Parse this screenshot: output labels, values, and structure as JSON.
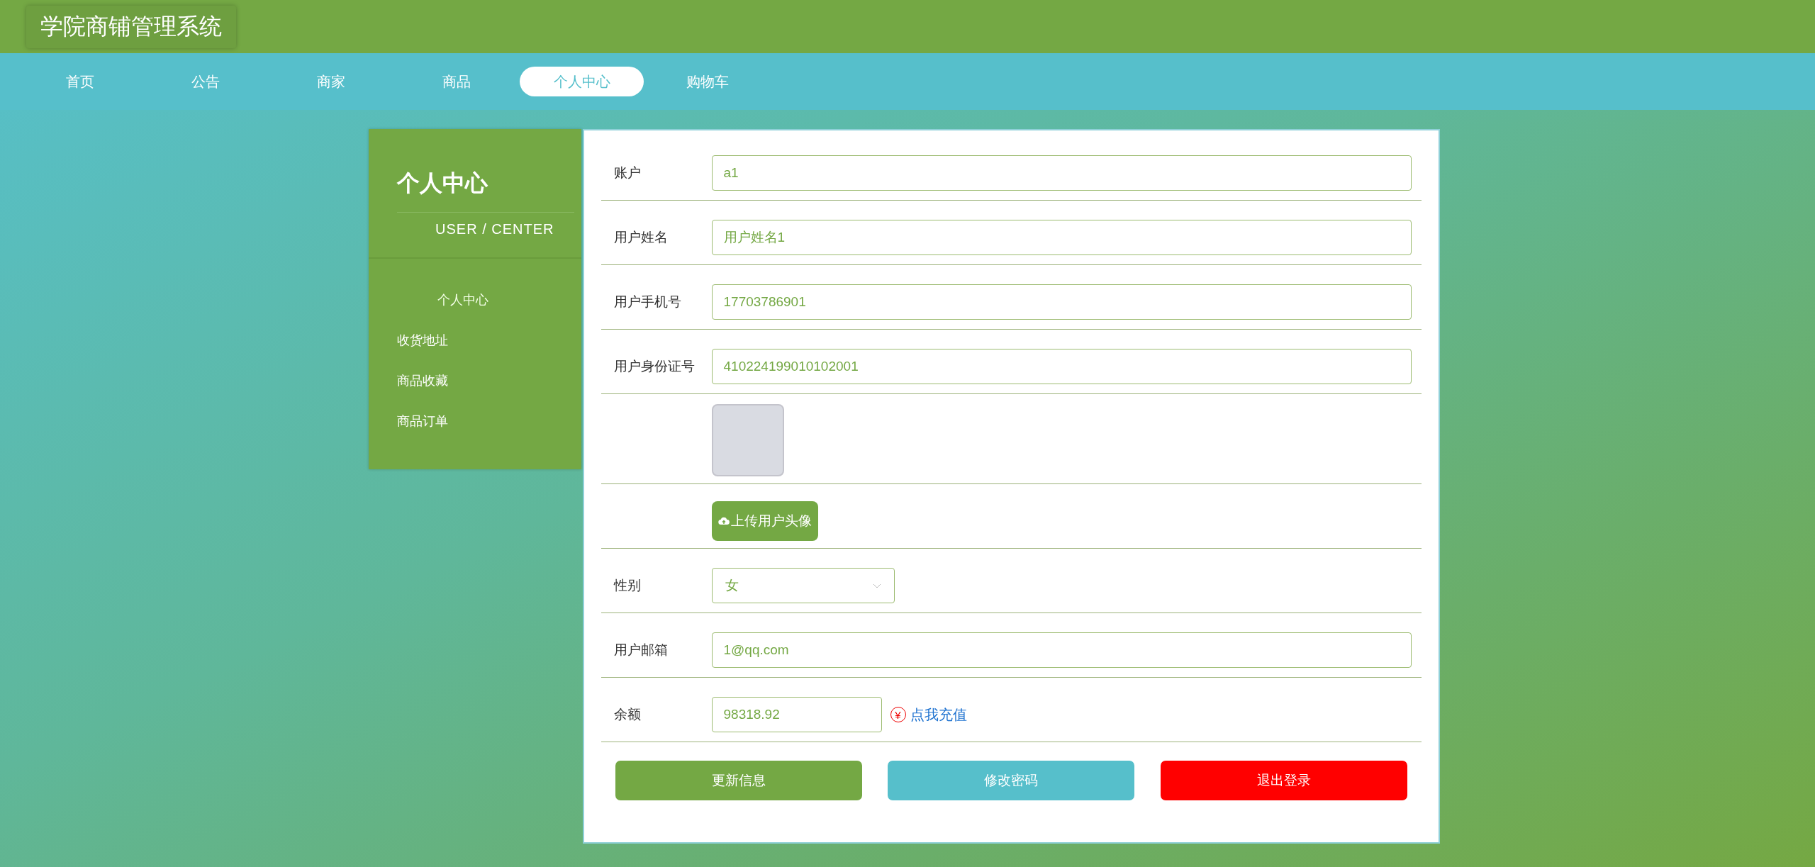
{
  "header": {
    "title": "学院商铺管理系统"
  },
  "nav": [
    {
      "label": "首页",
      "selected": false
    },
    {
      "label": "公告",
      "selected": false
    },
    {
      "label": "商家",
      "selected": false
    },
    {
      "label": "商品",
      "selected": false
    },
    {
      "label": "个人中心",
      "selected": true
    },
    {
      "label": "购物车",
      "selected": false
    }
  ],
  "sidebar": {
    "title": "个人中心",
    "subtitle": "USER / CENTER",
    "items": [
      {
        "label": "个人中心",
        "selected": true
      },
      {
        "label": "收货地址",
        "selected": false
      },
      {
        "label": "商品收藏",
        "selected": false
      },
      {
        "label": "商品订单",
        "selected": false
      }
    ]
  },
  "form": {
    "rows": [
      {
        "kind": "input",
        "label": "账户",
        "value": "a1"
      },
      {
        "kind": "input",
        "label": "用户姓名",
        "value": "用户姓名1"
      },
      {
        "kind": "input",
        "label": "用户手机号",
        "value": "17703786901"
      },
      {
        "kind": "input",
        "label": "用户身份证号",
        "value": "410224199010102001"
      },
      {
        "kind": "avatar"
      },
      {
        "kind": "upload",
        "button": "上传用户头像"
      },
      {
        "kind": "select",
        "label": "性别",
        "value": "女"
      },
      {
        "kind": "input",
        "label": "用户邮箱",
        "value": "1@qq.com"
      },
      {
        "kind": "balance",
        "label": "余额",
        "value": "98318.92",
        "link_icon": "¥",
        "link": "点我充值"
      }
    ],
    "buttons": [
      {
        "label": "更新信息",
        "color": "#74a844"
      },
      {
        "label": "修改密码",
        "color": "#56bfcb"
      },
      {
        "label": "退出登录",
        "color": "#ff0000"
      }
    ]
  }
}
